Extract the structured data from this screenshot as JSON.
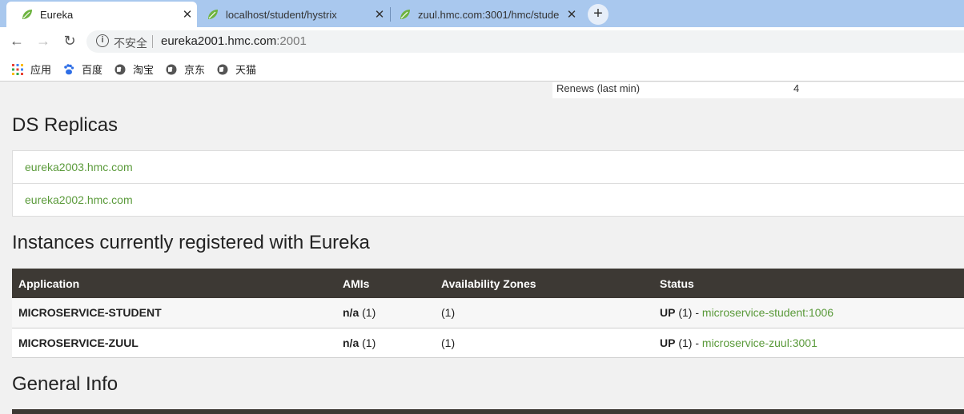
{
  "browser": {
    "tabs": [
      {
        "title": "Eureka",
        "active": true
      },
      {
        "title": "localhost/student/hystrix",
        "active": false
      },
      {
        "title": "zuul.hmc.com:3001/hmc/stude",
        "active": false
      }
    ],
    "new_tab": "+",
    "address": {
      "security_label": "不安全",
      "host": "eureka2001.hmc.com",
      "port": ":2001"
    },
    "bookmarks": [
      {
        "label": "应用",
        "icon": "apps-grid-icon"
      },
      {
        "label": "百度",
        "icon": "baidu-paw-icon"
      },
      {
        "label": "淘宝",
        "icon": "globe-icon"
      },
      {
        "label": "京东",
        "icon": "globe-icon"
      },
      {
        "label": "天猫",
        "icon": "globe-icon"
      }
    ]
  },
  "page": {
    "renews": {
      "label": "Renews (last min)",
      "value": "4"
    },
    "replicas_title": "DS Replicas",
    "replicas": [
      "eureka2003.hmc.com",
      "eureka2002.hmc.com"
    ],
    "instances_title": "Instances currently registered with Eureka",
    "instances_headers": [
      "Application",
      "AMIs",
      "Availability Zones",
      "Status"
    ],
    "instances": [
      {
        "application": "MICROSERVICE-STUDENT",
        "amis_bold": "n/a",
        "amis_count": "(1)",
        "zones": "(1)",
        "status_bold": "UP",
        "status_count": "(1) - ",
        "instance_link": "microservice-student:1006"
      },
      {
        "application": "MICROSERVICE-ZUUL",
        "amis_bold": "n/a",
        "amis_count": "(1)",
        "zones": "(1)",
        "status_bold": "UP",
        "status_count": "(1) - ",
        "instance_link": "microservice-zuul:3001"
      }
    ],
    "general_info_title": "General Info"
  },
  "colors": {
    "link": "#5a9a3a",
    "table_header": "#3d3934",
    "tabstrip": "#a9c8ee"
  }
}
